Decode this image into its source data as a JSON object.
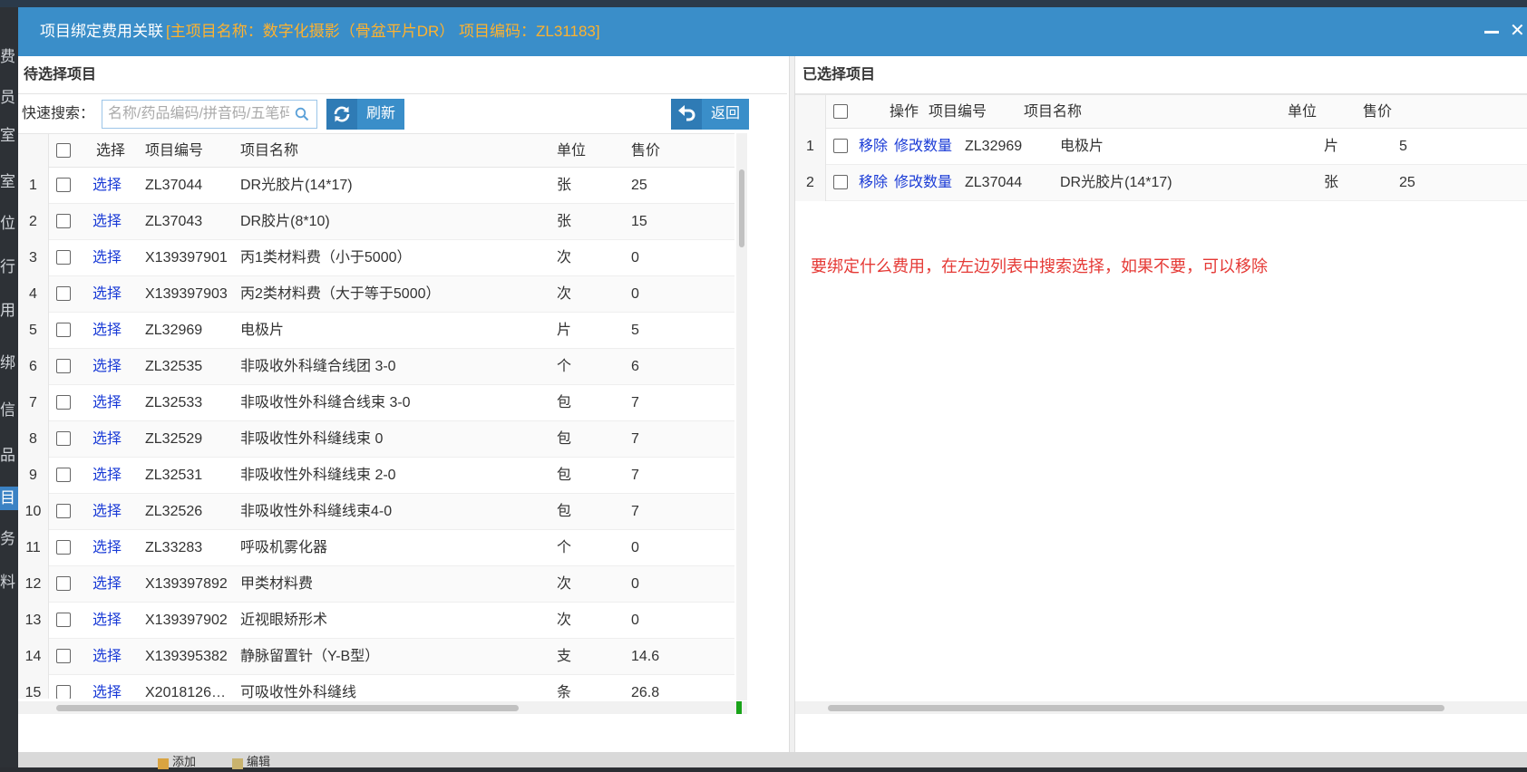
{
  "dialog": {
    "title": "项目绑定费用关联",
    "info": "[主项目名称：数字化摄影（骨盆平片DR） 项目编码：ZL31183]"
  },
  "background": {
    "sidebar_items": [
      "费",
      "员",
      "室",
      "室",
      "位",
      "行",
      "用",
      "绑",
      "信",
      "品",
      "目",
      "务",
      "料"
    ],
    "bottom_tabs": [
      "添加",
      "编辑"
    ]
  },
  "left": {
    "title": "待选择项目",
    "search": {
      "label": "快速搜索：",
      "placeholder": "名称/药品编码/拼音码/五笔码",
      "value": ""
    },
    "refresh_label": "刷新",
    "back_label": "返回",
    "columns": {
      "select": "选择",
      "code": "项目编号",
      "name": "项目名称",
      "unit": "单位",
      "price": "售价"
    },
    "rows": [
      {
        "n": "1",
        "action": "选择",
        "code": "ZL37044",
        "name": "DR光胶片(14*17)",
        "unit": "张",
        "price": "25"
      },
      {
        "n": "2",
        "action": "选择",
        "code": "ZL37043",
        "name": "DR胶片(8*10)",
        "unit": "张",
        "price": "15"
      },
      {
        "n": "3",
        "action": "选择",
        "code": "X139397901",
        "name": "丙1类材料费（小于5000）",
        "unit": "次",
        "price": "0"
      },
      {
        "n": "4",
        "action": "选择",
        "code": "X139397903",
        "name": "丙2类材料费（大于等于5000）",
        "unit": "次",
        "price": "0"
      },
      {
        "n": "5",
        "action": "选择",
        "code": "ZL32969",
        "name": "电极片",
        "unit": "片",
        "price": "5"
      },
      {
        "n": "6",
        "action": "选择",
        "code": "ZL32535",
        "name": "非吸收外科缝合线团 3-0",
        "unit": "个",
        "price": "6"
      },
      {
        "n": "7",
        "action": "选择",
        "code": "ZL32533",
        "name": "非吸收性外科缝合线束 3-0",
        "unit": "包",
        "price": "7"
      },
      {
        "n": "8",
        "action": "选择",
        "code": "ZL32529",
        "name": "非吸收性外科缝线束 0",
        "unit": "包",
        "price": "7"
      },
      {
        "n": "9",
        "action": "选择",
        "code": "ZL32531",
        "name": "非吸收性外科缝线束 2-0",
        "unit": "包",
        "price": "7"
      },
      {
        "n": "10",
        "action": "选择",
        "code": "ZL32526",
        "name": "非吸收性外科缝线束4-0",
        "unit": "包",
        "price": "7"
      },
      {
        "n": "11",
        "action": "选择",
        "code": "ZL33283",
        "name": "呼吸机雾化器",
        "unit": "个",
        "price": "0"
      },
      {
        "n": "12",
        "action": "选择",
        "code": "X139397892",
        "name": "甲类材料费",
        "unit": "次",
        "price": "0"
      },
      {
        "n": "13",
        "action": "选择",
        "code": "X139397902",
        "name": "近视眼矫形术",
        "unit": "次",
        "price": "0"
      },
      {
        "n": "14",
        "action": "选择",
        "code": "X139395382",
        "name": "静脉留置针（Y-B型）",
        "unit": "支",
        "price": "14.6"
      },
      {
        "n": "15",
        "action": "选择",
        "code": "X2018126…",
        "name": "可吸收性外科缝线",
        "unit": "条",
        "price": "26.8"
      }
    ]
  },
  "right": {
    "title": "已选择项目",
    "columns": {
      "action": "操作",
      "code": "项目编号",
      "name": "项目名称",
      "unit": "单位",
      "price": "售价"
    },
    "rows": [
      {
        "n": "1",
        "remove": "移除",
        "edit": "修改数量",
        "code": "ZL32969",
        "name": "电极片",
        "unit": "片",
        "price": "5"
      },
      {
        "n": "2",
        "remove": "移除",
        "edit": "修改数量",
        "code": "ZL37044",
        "name": "DR光胶片(14*17)",
        "unit": "张",
        "price": "25"
      }
    ],
    "annotation": "要绑定什么费用，在左边列表中搜索选择，如果不要，可以移除"
  }
}
